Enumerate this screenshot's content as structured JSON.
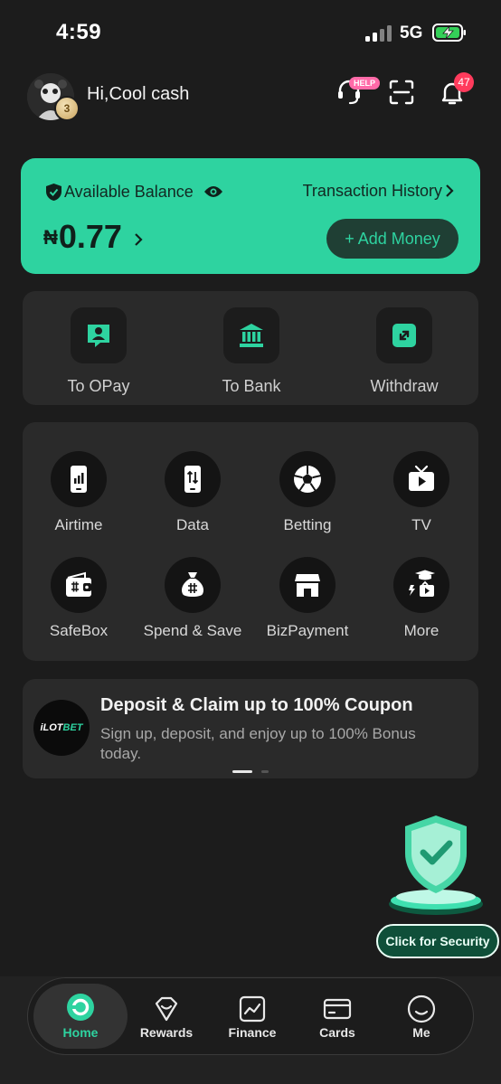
{
  "status_bar": {
    "time": "4:59",
    "network": "5G"
  },
  "header": {
    "greeting": "Hi,Cool cash",
    "avatar_badge": "3",
    "help_tag": "HELP",
    "notification_count": "47"
  },
  "balance": {
    "label": "Available Balance",
    "transaction_history": "Transaction History",
    "currency": "₦",
    "amount": "0.77",
    "add_money": "+ Add Money"
  },
  "transfer": [
    {
      "label": "To OPay",
      "icon": "person-chat-icon"
    },
    {
      "label": "To Bank",
      "icon": "bank-icon"
    },
    {
      "label": "Withdraw",
      "icon": "withdraw-arrows-icon"
    }
  ],
  "services": [
    {
      "label": "Airtime",
      "icon": "phone-signal-icon"
    },
    {
      "label": "Data",
      "icon": "phone-data-icon"
    },
    {
      "label": "Betting",
      "icon": "soccer-ball-icon"
    },
    {
      "label": "TV",
      "icon": "tv-icon"
    },
    {
      "label": "SafeBox",
      "icon": "wallet-icon"
    },
    {
      "label": "Spend & Save",
      "icon": "money-bag-icon"
    },
    {
      "label": "BizPayment",
      "icon": "storefront-icon"
    },
    {
      "label": "More",
      "icon": "more-grid-icon"
    }
  ],
  "promo": {
    "logo_text_a": "iLOT",
    "logo_text_b": "BET",
    "title": "Deposit & Claim up to 100% Coupon",
    "text": "Sign up, deposit, and enjoy up to 100% Bonus today."
  },
  "security": {
    "label": "Click for Security"
  },
  "tabs": [
    {
      "label": "Home",
      "icon": "home-icon",
      "active": true
    },
    {
      "label": "Rewards",
      "icon": "rewards-icon"
    },
    {
      "label": "Finance",
      "icon": "finance-chart-icon"
    },
    {
      "label": "Cards",
      "icon": "card-icon"
    },
    {
      "label": "Me",
      "icon": "profile-icon"
    }
  ],
  "colors": {
    "accent": "#2ed3a0",
    "background": "#1c1c1c",
    "panel": "#2a2a2a",
    "badge": "#ff3b5c"
  }
}
